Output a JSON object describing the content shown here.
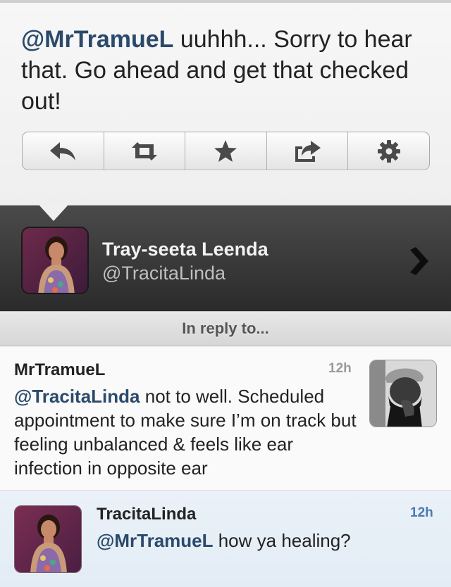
{
  "tweet": {
    "mention": "@MrTramueL",
    "text": " uuhhh... Sorry to hear that. Go ahead and get that checked out!"
  },
  "actions": [
    "reply-icon",
    "retweet-icon",
    "favorite-star-icon",
    "share-icon",
    "gear-icon"
  ],
  "profile": {
    "name": "Tray-seeta Leenda",
    "handle": "@TracitaLinda"
  },
  "reply_header": "In reply to...",
  "in_reply": {
    "author": "MrTramueL",
    "time": "12h",
    "mention": "@TracitaLinda",
    "text": " not to well. Scheduled appointment to make sure I’m on track but feeling unbalanced & feels like ear infection in opposite ear"
  },
  "tweet_item": {
    "author": "TracitaLinda",
    "time": "12h",
    "mention": "@MrTramueL",
    "text": " how ya healing?"
  },
  "colors": {
    "mention": "#2b4a6b",
    "timestamp_blue": "#4b7ab0",
    "profile_bar": "#333333"
  }
}
